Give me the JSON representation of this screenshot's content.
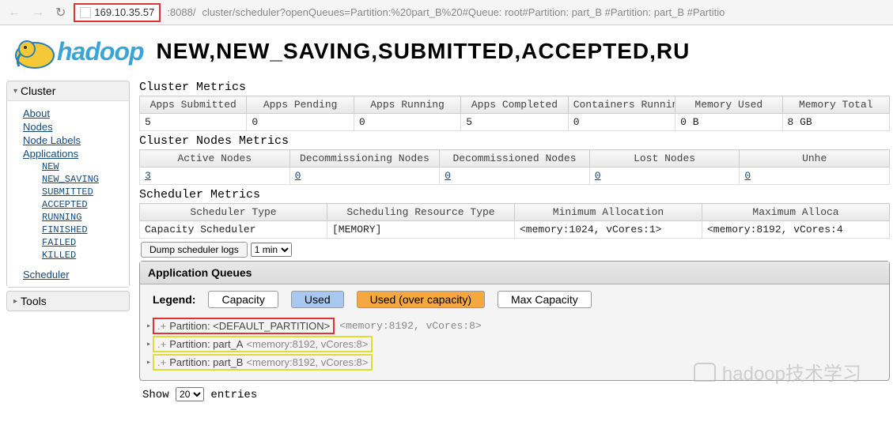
{
  "browser": {
    "url_host": "169.10.35.57",
    "url_port": ":8088/",
    "url_path": "cluster/scheduler?openQueues=Partition:%20part_B%20#Queue: root#Partition: part_B #Partition: part_B #Partitio"
  },
  "header": {
    "logo_text": "hadoop",
    "title": "NEW,NEW_SAVING,SUBMITTED,ACCEPTED,RU"
  },
  "sidebar": {
    "cluster_label": "Cluster",
    "tools_label": "Tools",
    "links": {
      "about": "About",
      "nodes": "Nodes",
      "node_labels": "Node Labels",
      "applications": "Applications",
      "scheduler": "Scheduler"
    },
    "app_states": [
      "NEW",
      "NEW_SAVING",
      "SUBMITTED",
      "ACCEPTED",
      "RUNNING",
      "FINISHED",
      "FAILED",
      "KILLED"
    ]
  },
  "cluster_metrics": {
    "title": "Cluster Metrics",
    "headers": [
      "Apps Submitted",
      "Apps Pending",
      "Apps Running",
      "Apps Completed",
      "Containers Running",
      "Memory Used",
      "Memory Total"
    ],
    "row": [
      "5",
      "0",
      "0",
      "5",
      "0",
      "0 B",
      "8 GB"
    ]
  },
  "nodes_metrics": {
    "title": "Cluster Nodes Metrics",
    "headers": [
      "Active Nodes",
      "Decommissioning Nodes",
      "Decommissioned Nodes",
      "Lost Nodes",
      "Unhe"
    ],
    "row": [
      "3",
      "0",
      "0",
      "0",
      "0"
    ]
  },
  "scheduler_metrics": {
    "title": "Scheduler Metrics",
    "headers": [
      "Scheduler Type",
      "Scheduling Resource Type",
      "Minimum Allocation",
      "Maximum Alloca"
    ],
    "row": [
      "Capacity Scheduler",
      "[MEMORY]",
      "<memory:1024, vCores:1>",
      "<memory:8192, vCores:4"
    ]
  },
  "dump": {
    "button": "Dump scheduler logs",
    "select": "1 min"
  },
  "queues": {
    "title": "Application Queues",
    "legend_label": "Legend:",
    "legend": {
      "capacity": "Capacity",
      "used": "Used",
      "over": "Used (over capacity)",
      "max": "Max Capacity"
    },
    "partitions": [
      {
        "label": "Partition: <DEFAULT_PARTITION>",
        "mem": "<memory:8192, vCores:8>",
        "hl": "red"
      },
      {
        "label": "Partition: part_A",
        "mem": "<memory:8192, vCores:8>",
        "hl": "yellow"
      },
      {
        "label": "Partition: part_B",
        "mem": "<memory:8192, vCores:8>",
        "hl": "yellow"
      }
    ]
  },
  "footer": {
    "show": "Show",
    "entries": "entries",
    "select": "20"
  },
  "watermark": "hadoop技术学习"
}
